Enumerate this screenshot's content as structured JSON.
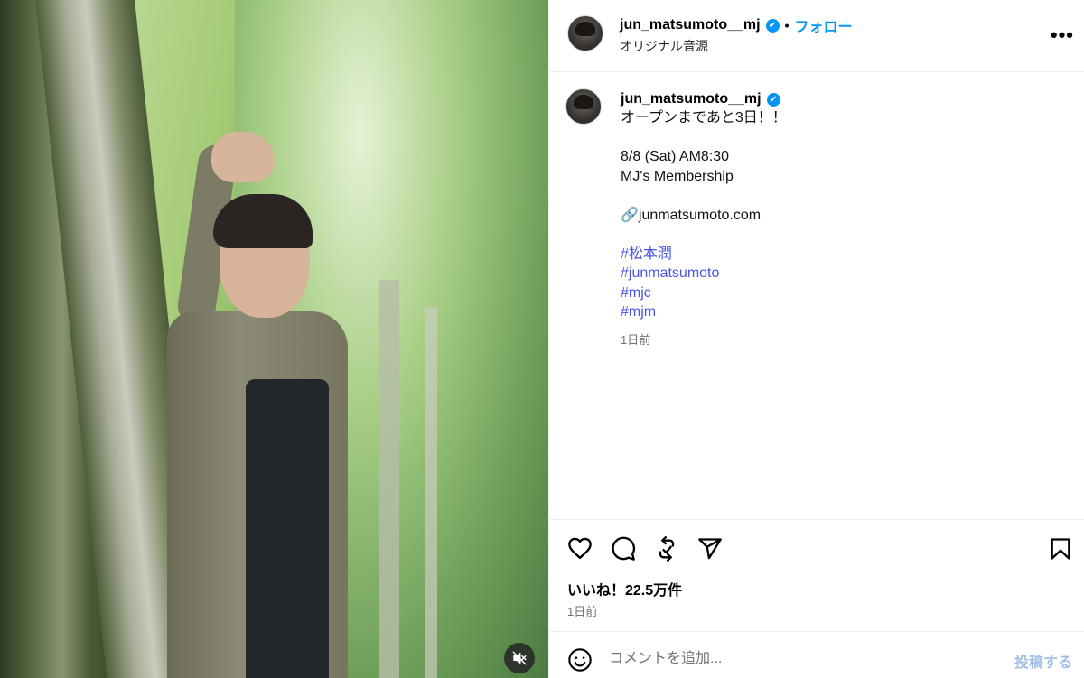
{
  "post": {
    "username": "jun_matsumoto__mj",
    "verified_badge": "✔",
    "separator": "•",
    "follow_label": "フォロー",
    "audio_label": "オリジナル音源",
    "more_label": "•••",
    "caption_lines": [
      "オープンまであと3日！！",
      "",
      "8/8 (Sat) AM8:30",
      "MJ's Membership",
      "",
      "🔗junmatsumoto.com",
      ""
    ],
    "hashtags": [
      "#松本潤",
      "#junmatsumoto",
      "#mjc",
      "#mjm"
    ],
    "caption_time": "1日前",
    "likes_text": "いいね！22.5万件",
    "post_time": "1日前"
  },
  "icons": {
    "like": "heart-icon",
    "comment": "comment-icon",
    "repost": "repost-icon",
    "share": "send-icon",
    "save": "bookmark-icon",
    "emoji": "emoji-icon",
    "mute": "muted-speaker-icon"
  },
  "comment": {
    "placeholder": "コメントを追加...",
    "post_label": "投稿する"
  },
  "colors": {
    "accent": "#0095f6",
    "hashtag": "#4a55e6",
    "muted_text": "#737373"
  }
}
